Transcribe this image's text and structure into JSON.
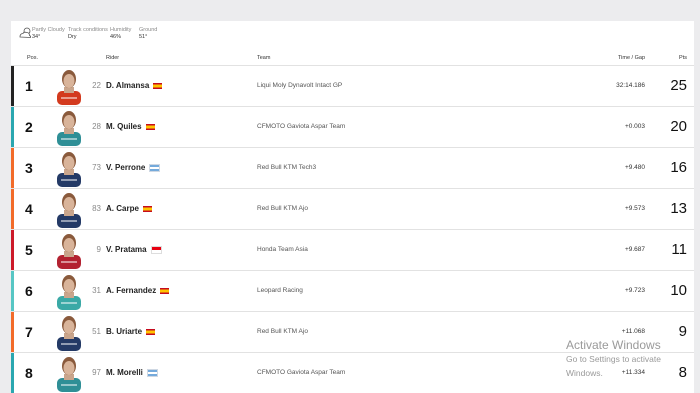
{
  "conditions": {
    "weather_label": "Partly Cloudy",
    "weather_value": "34°",
    "track_label": "Track conditions",
    "track_value": "Dry",
    "humidity_label": "Humidity",
    "humidity_value": "46%",
    "ground_label": "Ground",
    "ground_value": "51°"
  },
  "table": {
    "headers": {
      "pos": "Pos.",
      "rider": "Rider",
      "team": "Team",
      "time": "Time / Gap",
      "pts": "Pts"
    },
    "rows": [
      {
        "pos": "1",
        "number": "22",
        "rider": "D. Almansa",
        "flag": "es",
        "team": "Liqui Moly Dynavolt Intact GP",
        "time": "32:14.186",
        "pts": "25",
        "accent": "#222222",
        "kit": "#d33a1e"
      },
      {
        "pos": "2",
        "number": "28",
        "rider": "M. Quiles",
        "flag": "es",
        "team": "CFMOTO Gaviota Aspar Team",
        "time": "+0.003",
        "pts": "20",
        "accent": "#2aa7b0",
        "kit": "#2f8f96"
      },
      {
        "pos": "3",
        "number": "73",
        "rider": "V. Perrone",
        "flag": "ar",
        "team": "Red Bull KTM Tech3",
        "time": "+9.480",
        "pts": "16",
        "accent": "#f26b2a",
        "kit": "#243a66"
      },
      {
        "pos": "4",
        "number": "83",
        "rider": "A. Carpe",
        "flag": "es",
        "team": "Red Bull KTM Ajo",
        "time": "+9.573",
        "pts": "13",
        "accent": "#f26b2a",
        "kit": "#243a66"
      },
      {
        "pos": "5",
        "number": "9",
        "rider": "V. Pratama",
        "flag": "id",
        "team": "Honda Team Asia",
        "time": "+9.687",
        "pts": "11",
        "accent": "#cc1a2a",
        "kit": "#b32231"
      },
      {
        "pos": "6",
        "number": "31",
        "rider": "A. Fernandez",
        "flag": "es",
        "team": "Leopard Racing",
        "time": "+9.723",
        "pts": "10",
        "accent": "#57c6c4",
        "kit": "#3aa9a6"
      },
      {
        "pos": "7",
        "number": "51",
        "rider": "B. Uriarte",
        "flag": "es",
        "team": "Red Bull KTM Ajo",
        "time": "+11.068",
        "pts": "9",
        "accent": "#f26b2a",
        "kit": "#243a66"
      },
      {
        "pos": "8",
        "number": "97",
        "rider": "M. Morelli",
        "flag": "ar",
        "team": "CFMOTO Gaviota Aspar Team",
        "time": "+11.334",
        "pts": "8",
        "accent": "#2aa7b0",
        "kit": "#2f8f96"
      }
    ]
  },
  "watermark": {
    "title": "Activate Windows",
    "subtitle": "Go to Settings to activate Windows."
  }
}
